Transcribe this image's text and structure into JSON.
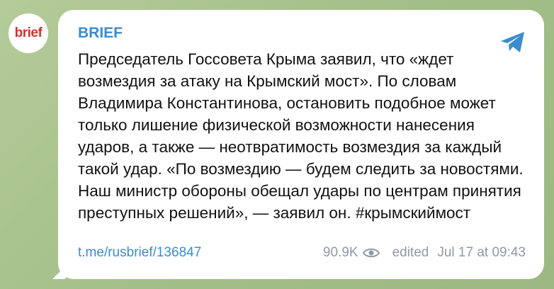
{
  "avatar": {
    "text": "brief"
  },
  "post": {
    "channel": "BRIEF",
    "text": "Председатель Госсовета Крыма заявил, что «ждет возмездия за атаку на Крымский мост». По словам Владимира Константинова, остановить подобное может только лишение физической возможности нанесения ударов, а также — неотвратимость возмездия за каждый такой удар. «По возмездию — будем следить за новостями. Наш министр обороны обещал удары по центрам принятия преступных решений», — заявил он. #крымскиймост",
    "link": "t.me/rusbrief/136847",
    "views": "90.9K",
    "edited": "edited",
    "time": "Jul 17 at 09:43"
  },
  "icons": {
    "share": "telegram-share-icon",
    "views": "eye-icon"
  },
  "colors": {
    "accent": "#3a8ccf",
    "brand_red": "#d0322c",
    "muted": "#8d9aa6",
    "background": "#a9c28f"
  }
}
